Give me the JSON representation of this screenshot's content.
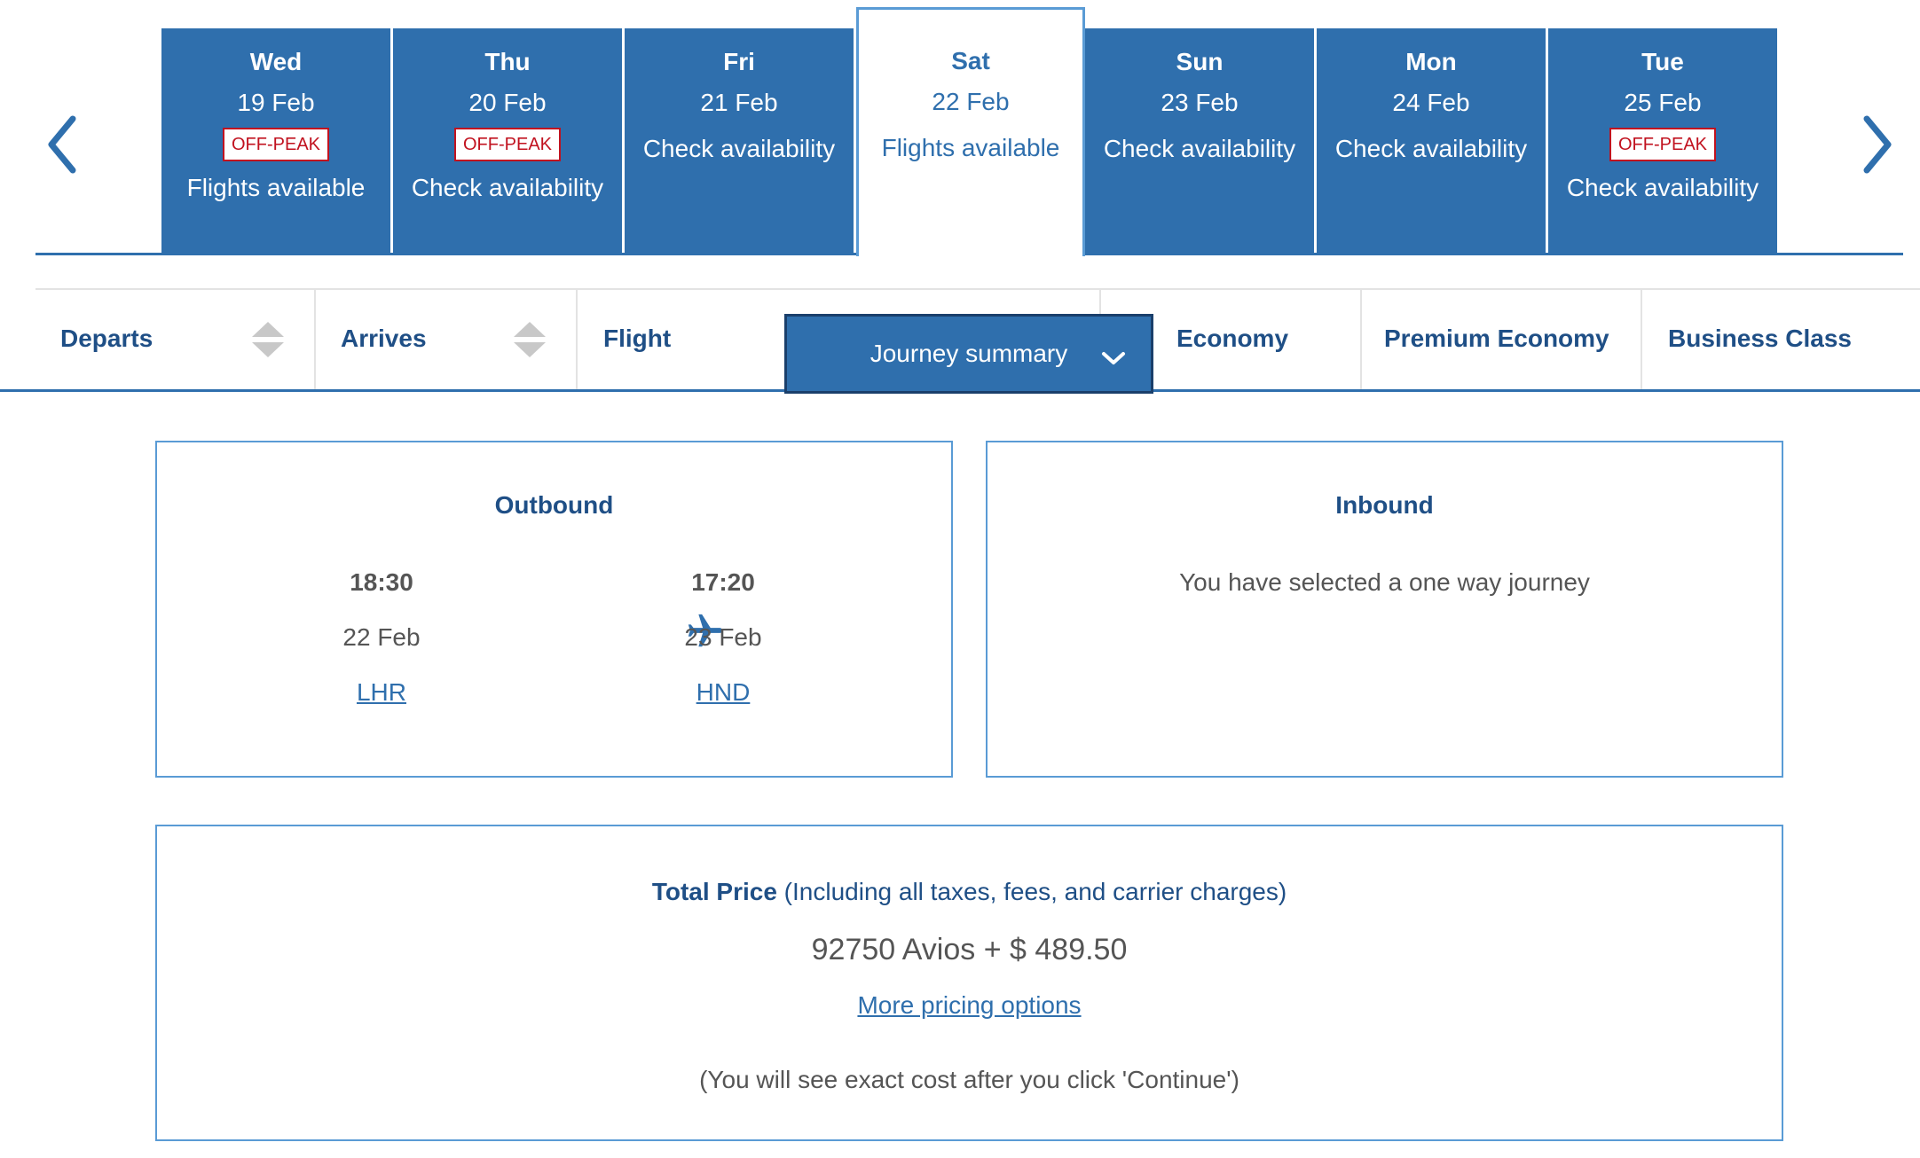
{
  "carousel": {
    "prev_icon": "chevron-left-icon",
    "next_icon": "chevron-right-icon",
    "accent_color": "#2f6fad",
    "days": [
      {
        "day": "Wed",
        "date": "19 Feb",
        "badge": "OFF-PEAK",
        "status": "Flights available",
        "selected": false
      },
      {
        "day": "Thu",
        "date": "20 Feb",
        "badge": "OFF-PEAK",
        "status": "Check availability",
        "selected": false
      },
      {
        "day": "Fri",
        "date": "21 Feb",
        "badge": "",
        "status": "Check availability",
        "selected": false
      },
      {
        "day": "Sat",
        "date": "22 Feb",
        "badge": "",
        "status": "Flights available",
        "selected": true
      },
      {
        "day": "Sun",
        "date": "23 Feb",
        "badge": "",
        "status": "Check availability",
        "selected": false
      },
      {
        "day": "Mon",
        "date": "24 Feb",
        "badge": "",
        "status": "Check availability",
        "selected": false
      },
      {
        "day": "Tue",
        "date": "25 Feb",
        "badge": "OFF-PEAK",
        "status": "Check availability",
        "selected": false
      }
    ]
  },
  "columns": {
    "departs": "Departs",
    "arrives": "Arrives",
    "flight": "Flight",
    "journey_summary": "Journey summary",
    "economy": "Economy",
    "premium_economy": "Premium Economy",
    "business": "Business Class"
  },
  "outbound": {
    "title": "Outbound",
    "depart_time": "18:30",
    "depart_date": "22 Feb",
    "depart_airport": "LHR",
    "arrive_time": "17:20",
    "arrive_date": "23 Feb",
    "arrive_airport": "HND",
    "icon": "plane-icon"
  },
  "inbound": {
    "title": "Inbound",
    "message": "You have selected a one way journey"
  },
  "price": {
    "title": "Total Price",
    "title_suffix": " (Including all taxes, fees, and carrier charges)",
    "amount": "92750 Avios + $ 489.50",
    "link": "More pricing options",
    "note": "(You will see exact cost after you click 'Continue')"
  }
}
